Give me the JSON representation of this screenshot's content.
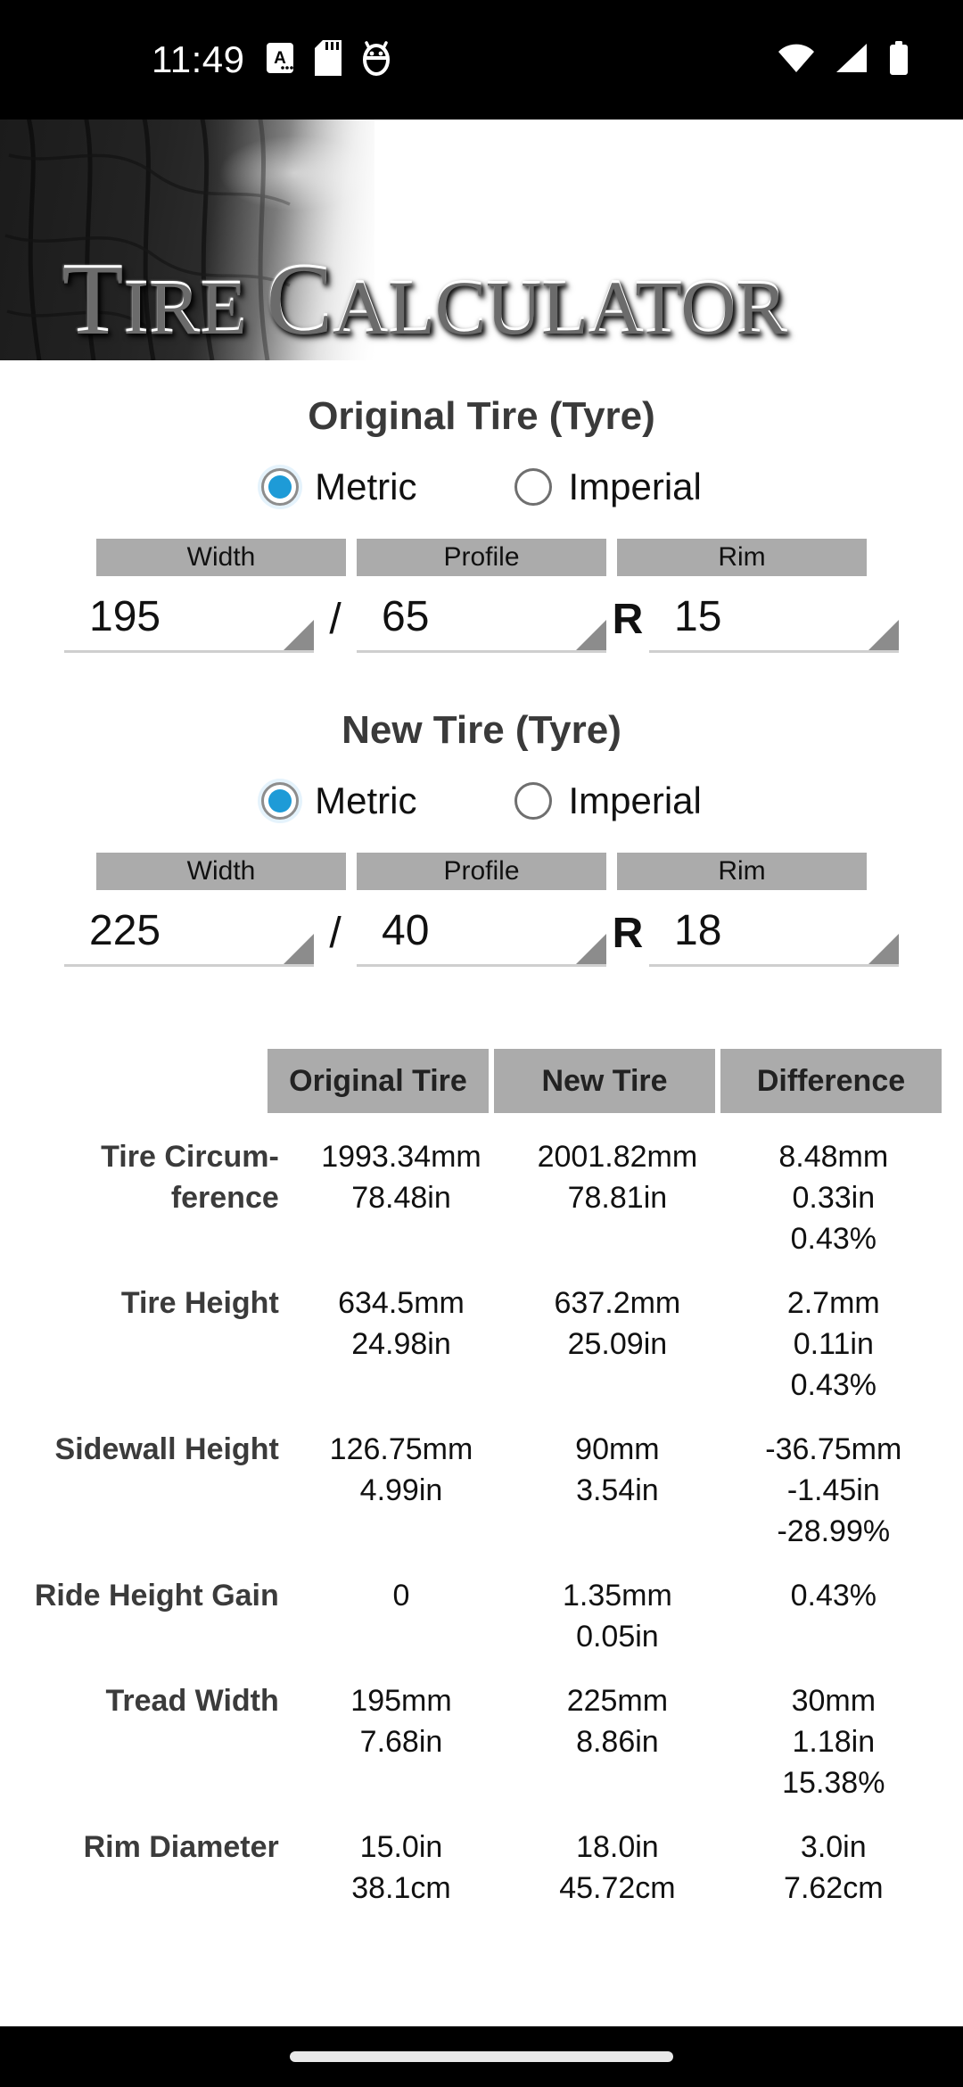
{
  "status_bar": {
    "clock": "11:49",
    "left_icons": [
      "keyboard-a-icon",
      "sd-card-icon",
      "android-debug-icon"
    ],
    "right_icons": [
      "wifi-icon",
      "cellular-signal-icon",
      "battery-icon"
    ]
  },
  "banner": {
    "title_first": "T",
    "title_rest": "IRE ",
    "title_second": "C",
    "title_second_rest": "ALCULATOR"
  },
  "original": {
    "title": "Original Tire (Tyre)",
    "units": {
      "metric": "Metric",
      "imperial": "Imperial",
      "selected": "Metric"
    },
    "headers": {
      "width": "Width",
      "profile": "Profile",
      "rim": "Rim"
    },
    "values": {
      "width": "195",
      "profile": "65",
      "rim": "15"
    },
    "separator_slash": "/",
    "separator_r": "R"
  },
  "new": {
    "title": "New Tire (Tyre)",
    "units": {
      "metric": "Metric",
      "imperial": "Imperial",
      "selected": "Metric"
    },
    "headers": {
      "width": "Width",
      "profile": "Profile",
      "rim": "Rim"
    },
    "values": {
      "width": "225",
      "profile": "40",
      "rim": "18"
    },
    "separator_slash": "/",
    "separator_r": "R"
  },
  "results": {
    "columns": [
      "Original Tire",
      "New Tire",
      "Difference"
    ],
    "rows": [
      {
        "label": "Tire Circum-ference",
        "original": "1993.34mm\n78.48in",
        "new": "2001.82mm\n78.81in",
        "difference": "8.48mm\n0.33in\n0.43%"
      },
      {
        "label": "Tire Height",
        "original": "634.5mm\n24.98in",
        "new": "637.2mm\n25.09in",
        "difference": "2.7mm\n0.11in\n0.43%"
      },
      {
        "label": "Sidewall Height",
        "original": "126.75mm\n4.99in",
        "new": "90mm\n3.54in",
        "difference": "-36.75mm\n-1.45in\n-28.99%"
      },
      {
        "label": "Ride Height Gain",
        "original": "0",
        "new": "1.35mm\n0.05in",
        "difference": "0.43%"
      },
      {
        "label": "Tread Width",
        "original": "195mm\n7.68in",
        "new": "225mm\n8.86in",
        "difference": "30mm\n1.18in\n15.38%"
      },
      {
        "label": "Rim Diameter",
        "original": "15.0in\n38.1cm",
        "new": "18.0in\n45.72cm",
        "difference": "3.0in\n7.62cm"
      }
    ]
  },
  "colors": {
    "radio_accent": "#1E9BD7",
    "header_band": "#ABABAB",
    "status_bar_bg": "#000000",
    "text": "#111111"
  }
}
